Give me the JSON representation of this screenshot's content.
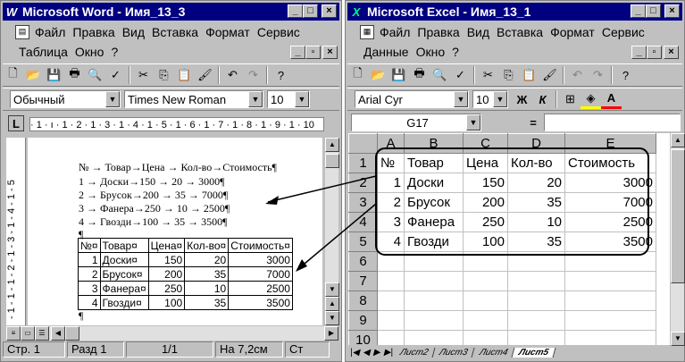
{
  "word": {
    "title": "Microsoft Word - Имя_13_3",
    "menu1": [
      "Файл",
      "Правка",
      "Вид",
      "Вставка",
      "Формат",
      "Сервис"
    ],
    "menu2": [
      "Таблица",
      "Окно",
      "?"
    ],
    "style": "Обычный",
    "font": "Times New Roman",
    "size": "10",
    "ruler_text": "· 1 · ı · 1 · 2 · 1 · 3 · 1 · 4 · 1 · 5 · 1 · 6 · 1 · 7 · 1 · 8 · 1 · 9 · 1 · 10",
    "tab_text": [
      "№   →   Товар→Цена → Кол-во→Стоимость¶",
      "1    →   Доски→150  →  20    →   3000¶",
      "2    →   Брусок→200  →  35    →   7000¶",
      "3    →   Фанера→250  →  10    →   2500¶",
      "4    →   Гвозди→100  →  35    →   3500¶",
      "¶"
    ],
    "table_header": [
      "№¤",
      "Товар¤",
      "Цена¤",
      "Кол-во¤",
      "Стоимость¤"
    ],
    "table_rows": [
      [
        "1",
        "Доски¤",
        "150",
        "20",
        "3000"
      ],
      [
        "2",
        "Брусок¤",
        "200",
        "35",
        "7000"
      ],
      [
        "3",
        "Фанера¤",
        "250",
        "10",
        "2500"
      ],
      [
        "4",
        "Гвозди¤",
        "100",
        "35",
        "3500"
      ]
    ],
    "end_mark": "¶",
    "status": [
      "Стр. 1",
      "Разд 1",
      "1/1",
      "На 7,2см",
      "Ст"
    ],
    "vruler": "- 1 - 1 - 1 - 2 - 1 - 3 - 1 - 4 - 1 - 5"
  },
  "excel": {
    "title": "Microsoft Excel - Имя_13_1",
    "menu1": [
      "Файл",
      "Правка",
      "Вид",
      "Вставка",
      "Формат",
      "Сервис"
    ],
    "menu2": [
      "Данные",
      "Окно",
      "?"
    ],
    "font": "Arial Cyr",
    "size": "10",
    "bold": "Ж",
    "italic": "К",
    "underline_a": "A",
    "namebox": "G17",
    "equals": "=",
    "cols": [
      "A",
      "B",
      "C",
      "D",
      "E"
    ],
    "rows": [
      [
        "1",
        "№",
        "Товар",
        "Цена",
        "Кол-во",
        "Стоимость"
      ],
      [
        "2",
        "1",
        "Доски",
        "150",
        "20",
        "3000"
      ],
      [
        "3",
        "2",
        "Брусок",
        "200",
        "35",
        "7000"
      ],
      [
        "4",
        "3",
        "Фанера",
        "250",
        "10",
        "2500"
      ],
      [
        "5",
        "4",
        "Гвозди",
        "100",
        "35",
        "3500"
      ],
      [
        "6",
        "",
        "",
        "",
        "",
        ""
      ],
      [
        "7",
        "",
        "",
        "",
        "",
        ""
      ],
      [
        "8",
        "",
        "",
        "",
        "",
        ""
      ],
      [
        "9",
        "",
        "",
        "",
        "",
        ""
      ],
      [
        "10",
        "",
        "",
        "",
        "",
        ""
      ]
    ],
    "sheets": [
      "Лист2",
      "Лист3",
      "Лист4",
      "Лист5"
    ]
  },
  "colors": {
    "titlebar": "#000080",
    "face": "#c0c0c0"
  }
}
